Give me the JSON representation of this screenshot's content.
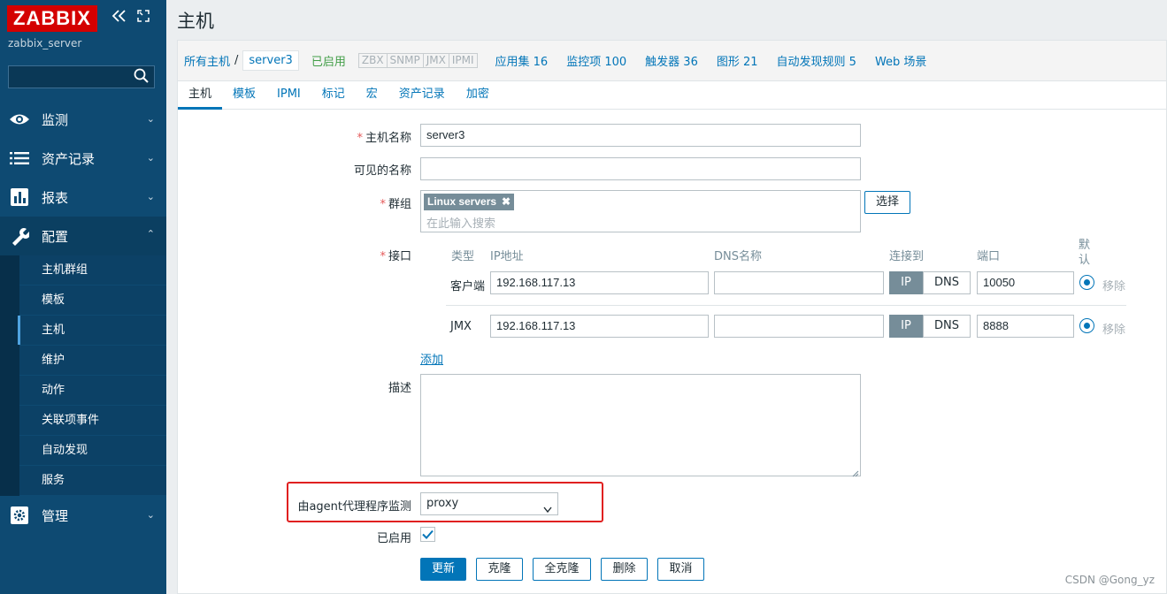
{
  "sidebar": {
    "logo": "ZABBIX",
    "server_name": "zabbix_server",
    "search_value": "",
    "sections": [
      {
        "label": "监测",
        "icon": "eye-icon"
      },
      {
        "label": "资产记录",
        "icon": "list-icon"
      },
      {
        "label": "报表",
        "icon": "bar-chart-icon"
      },
      {
        "label": "配置",
        "icon": "wrench-icon"
      },
      {
        "label": "管理",
        "icon": "gear-icon"
      }
    ],
    "config_items": [
      "主机群组",
      "模板",
      "主机",
      "维护",
      "动作",
      "关联项事件",
      "自动发现",
      "服务"
    ]
  },
  "page": {
    "title": "主机"
  },
  "host_nav": {
    "all_hosts": "所有主机",
    "separator": "/",
    "current_host": "server3",
    "status": "已启用",
    "availability": [
      "ZBX",
      "SNMP",
      "JMX",
      "IPMI"
    ],
    "links": [
      "应用集 16",
      "监控项 100",
      "触发器 36",
      "图形 21",
      "自动发现规则 5",
      "Web 场景"
    ]
  },
  "tabs": [
    "主机",
    "模板",
    "IPMI",
    "标记",
    "宏",
    "资产记录",
    "加密"
  ],
  "form": {
    "host_name_label": "主机名称",
    "host_name_value": "server3",
    "visible_name_label": "可见的名称",
    "visible_name_value": "",
    "groups_label": "群组",
    "group_chip": "Linux servers",
    "groups_placeholder": "在此输入搜索",
    "select_button": "选择",
    "interfaces_label": "接口",
    "if_headers": {
      "type": "类型",
      "ip": "IP地址",
      "dns": "DNS名称",
      "connect": "连接到",
      "port": "端口",
      "default": "默认"
    },
    "interfaces": [
      {
        "type": "客户端",
        "ip": "192.168.117.13",
        "dns": "",
        "ip_btn": "IP",
        "dns_btn": "DNS",
        "port": "10050",
        "remove": "移除"
      },
      {
        "type": "JMX",
        "ip": "192.168.117.13",
        "dns": "",
        "ip_btn": "IP",
        "dns_btn": "DNS",
        "port": "8888",
        "remove": "移除"
      }
    ],
    "add_link": "添加",
    "description_label": "描述",
    "proxy_label": "由agent代理程序监测",
    "proxy_value": "proxy",
    "enabled_label": "已启用",
    "buttons": {
      "update": "更新",
      "clone": "克隆",
      "full_clone": "全克隆",
      "delete": "删除",
      "cancel": "取消"
    }
  },
  "watermark": "CSDN @Gong_yz",
  "colors": {
    "sidebar": "#0e4a72",
    "accent": "#0275b8",
    "logo": "#d40000",
    "highlight": "#e02020"
  }
}
